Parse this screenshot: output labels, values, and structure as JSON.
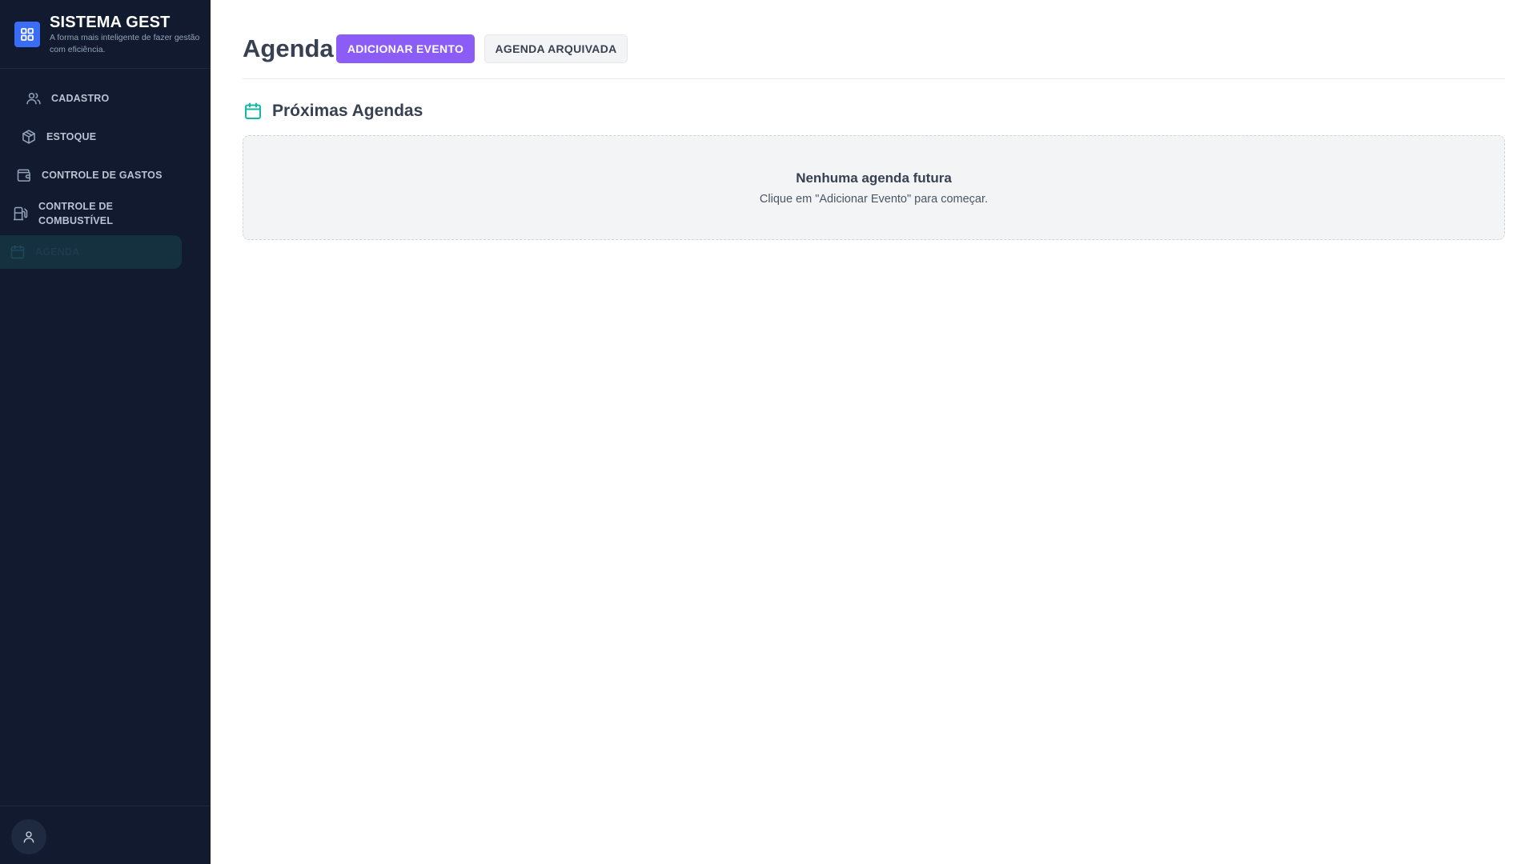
{
  "sidebar": {
    "brand": {
      "title": "SISTEMA GEST",
      "subtitle": "A forma mais inteligente de fazer gestão com eficiência.",
      "logo_icon": "grid-icon",
      "logo_color": "#3b6cf6"
    },
    "items": [
      {
        "label": "CADASTRO",
        "icon": "users-icon"
      },
      {
        "label": "ESTOQUE",
        "icon": "package-icon"
      },
      {
        "label": "CONTROLE DE GASTOS",
        "icon": "wallet-icon"
      },
      {
        "label": "CONTROLE DE COMBUSTÍVEL",
        "icon": "fuel-icon"
      },
      {
        "label": "AGENDA",
        "icon": "calendar-icon",
        "active": true
      }
    ],
    "footer": {
      "avatar_icon": "user-icon"
    },
    "background": "#111a2e"
  },
  "main": {
    "title": "Agenda",
    "buttons": {
      "add_event": "ADICIONAR EVENTO",
      "archived": "AGENDA ARQUIVADA"
    },
    "section": {
      "title": "Próximas Agendas",
      "icon": "calendar-icon",
      "icon_color": "#14b8a6"
    },
    "empty_state": {
      "title": "Nenhuma agenda futura",
      "text": "Clique em \"Adicionar Evento\" para começar."
    },
    "accent_color": "#8b5cf6"
  }
}
